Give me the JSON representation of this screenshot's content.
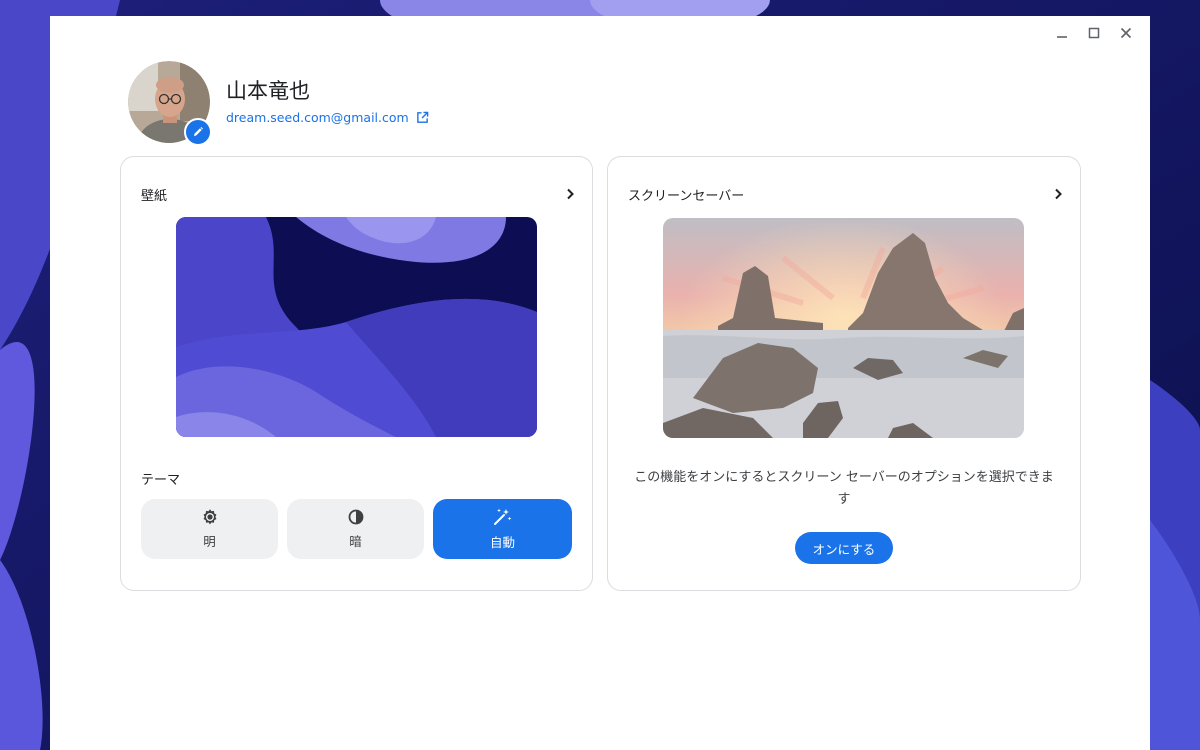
{
  "window": {
    "minimize_icon": "minimize-icon",
    "maximize_icon": "maximize-icon",
    "close_icon": "close-icon"
  },
  "profile": {
    "name": "山本竜也",
    "email": "dream.seed.com@gmail.com",
    "edit_icon": "pencil-icon",
    "external_icon": "open-in-new-icon"
  },
  "wallpaper": {
    "title": "壁紙",
    "theme_label": "テーマ",
    "themes": [
      {
        "label": "明",
        "icon": "sun-gear-icon",
        "selected": false
      },
      {
        "label": "暗",
        "icon": "contrast-icon",
        "selected": false
      },
      {
        "label": "自動",
        "icon": "magic-wand-icon",
        "selected": true
      }
    ]
  },
  "screensaver": {
    "title": "スクリーンセーバー",
    "description": "この機能をオンにするとスクリーン セーバーのオプションを選択できます",
    "button_label": "オンにする"
  },
  "colors": {
    "accent": "#1a73e8",
    "desktop_dark": "#0b0f4a",
    "desktop_purple": "#5a56d6"
  }
}
